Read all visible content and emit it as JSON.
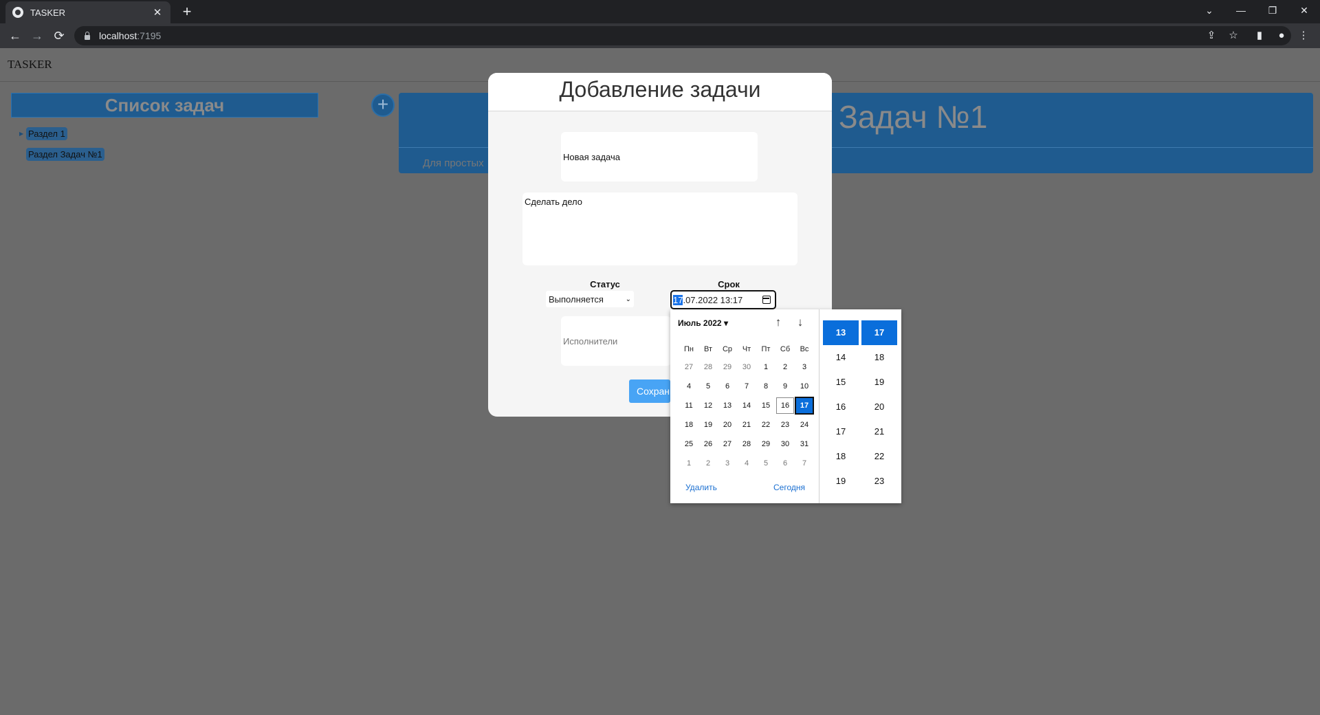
{
  "browser": {
    "tab_title": "TASKER",
    "tab_close": "✕",
    "new_tab": "+",
    "host": "localhost",
    "port": ":7195",
    "back": "←",
    "forward": "→",
    "reload": "⟳",
    "minimize": "—",
    "restore": "❐",
    "close": "✕",
    "tab_search": "⌄",
    "share": "⇪",
    "bookmark": "☆",
    "sidepanel": "▮",
    "profile": "●",
    "menu": "⋮"
  },
  "app": {
    "brand": "TASKER",
    "list_header": "Список задач",
    "tree": [
      {
        "label": "Раздел 1",
        "arrow": "▶"
      },
      {
        "label": "Раздел Задач №1"
      }
    ],
    "add_button": "+",
    "section_title": "Задач №1",
    "section_desc": "Для простых"
  },
  "modal": {
    "title": "Добавление задачи",
    "name_value": "Новая задача",
    "description_value": "Сделать дело",
    "status_label": "Статус",
    "status_value": "Выполняется",
    "status_chevron": "⌄",
    "due_label": "Срок",
    "due_day": "17",
    "due_rest": ".07.2022 13:17",
    "executors_placeholder": "Исполнители",
    "save_label": "Сохранить"
  },
  "picker": {
    "month_label": "Июль 2022 ▾",
    "up": "↑",
    "down": "↓",
    "weekdays": [
      "Пн",
      "Вт",
      "Ср",
      "Чт",
      "Пт",
      "Сб",
      "Вс"
    ],
    "weeks": [
      [
        "27",
        "28",
        "29",
        "30",
        "1",
        "2",
        "3"
      ],
      [
        "4",
        "5",
        "6",
        "7",
        "8",
        "9",
        "10"
      ],
      [
        "11",
        "12",
        "13",
        "14",
        "15",
        "16",
        "17"
      ],
      [
        "18",
        "19",
        "20",
        "21",
        "22",
        "23",
        "24"
      ],
      [
        "25",
        "26",
        "27",
        "28",
        "29",
        "30",
        "31"
      ],
      [
        "1",
        "2",
        "3",
        "4",
        "5",
        "6",
        "7"
      ]
    ],
    "muted_first_row": 4,
    "today": "16",
    "selected": "17",
    "clear_label": "Удалить",
    "today_label": "Сегодня",
    "hours": [
      "13",
      "14",
      "15",
      "16",
      "17",
      "18",
      "19"
    ],
    "minutes": [
      "17",
      "18",
      "19",
      "20",
      "21",
      "22",
      "23"
    ],
    "selected_hour": "13",
    "selected_minute": "17"
  }
}
